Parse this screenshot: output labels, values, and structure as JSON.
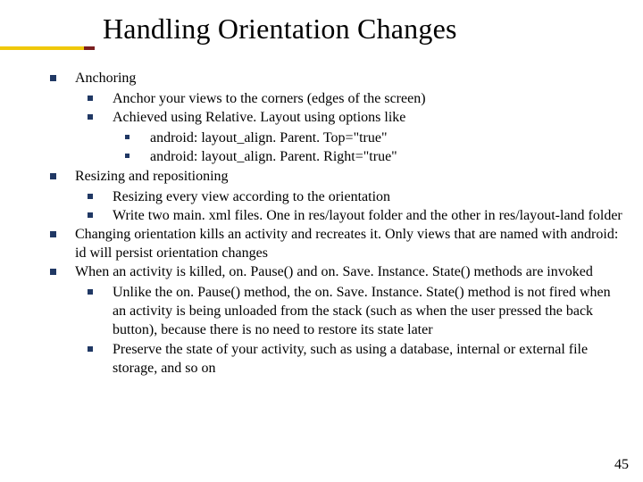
{
  "title": "Handling Orientation Changes",
  "bullets": [
    {
      "text": "Anchoring",
      "sub": [
        {
          "text": "Anchor your views to the corners (edges of the screen)"
        },
        {
          "text": "Achieved using Relative. Layout using options like",
          "sub": [
            {
              "text": "android: layout_align. Parent. Top=\"true\""
            },
            {
              "text": "android: layout_align. Parent. Right=\"true\""
            }
          ]
        }
      ]
    },
    {
      "text": "Resizing and repositioning",
      "sub": [
        {
          "text": "Resizing every view according to the orientation"
        },
        {
          "text": "Write two main. xml files. One in res/layout folder and the other in res/layout-land folder"
        }
      ]
    },
    {
      "text": "Changing orientation kills an activity and recreates it. Only views that are named with android: id will persist orientation changes"
    },
    {
      "text": "When an activity is killed, on. Pause() and on. Save. Instance. State() methods are invoked",
      "sub": [
        {
          "text": "Unlike the on. Pause() method, the on. Save. Instance. State() method is not fired when an activity is being unloaded from the stack (such as when the user pressed the back button), because there is no need to restore its state later"
        },
        {
          "text": "Preserve the state of your activity, such as using a database, internal or external file storage, and so on"
        }
      ]
    }
  ],
  "page_number": "45"
}
